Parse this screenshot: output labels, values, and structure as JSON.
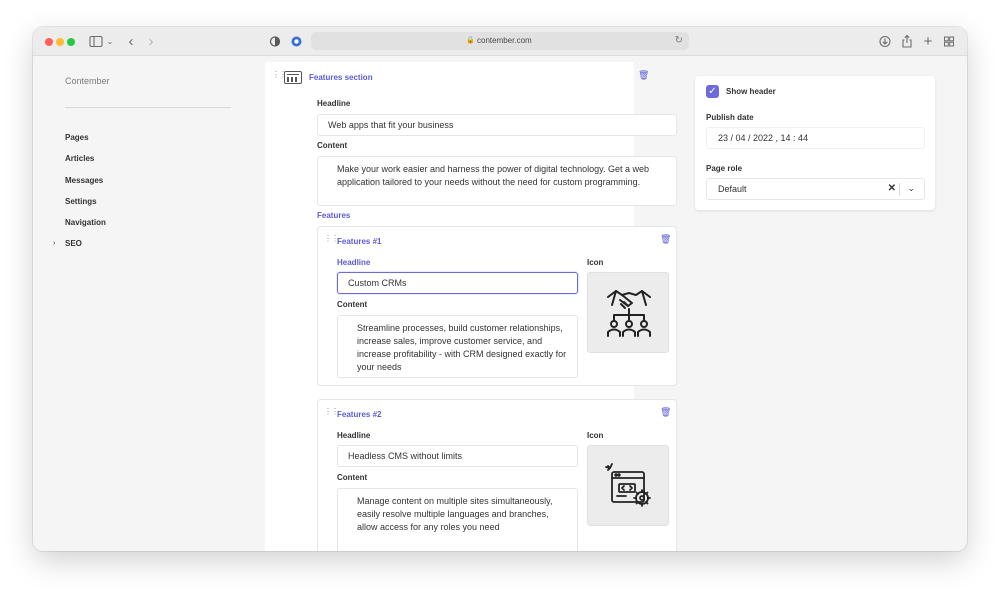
{
  "browser": {
    "url": "contember.com",
    "icons": {
      "sidebar_toggle": "sidebar-icon",
      "back": "chevron-left-icon",
      "forward": "chevron-right-icon",
      "shield": "shield-icon",
      "extension": "extension-icon",
      "lock": "lock-icon",
      "reload": "reload-icon",
      "download": "download-icon",
      "share": "share-icon",
      "new_tab": "plus-icon",
      "tab_overview": "grid-icon"
    }
  },
  "sidebar": {
    "brand": "Contember",
    "items": [
      {
        "label": "Pages"
      },
      {
        "label": "Articles"
      },
      {
        "label": "Messages"
      },
      {
        "label": "Settings"
      },
      {
        "label": "Navigation"
      },
      {
        "label": "SEO",
        "expandable": true
      }
    ]
  },
  "section": {
    "title": "Features section",
    "headline_label": "Headline",
    "headline_value": "Web apps that fit your business",
    "content_label": "Content",
    "content_value": "Make your work easier and harness the power of digital technology. Get a web application tailored to your needs without the need for custom programming.",
    "features_label": "Features",
    "features": [
      {
        "title": "Features #1",
        "headline_label": "Headline",
        "headline_value": "Custom CRMs",
        "content_label": "Content",
        "content_value": "Streamline processes, build customer relationships, increase sales, improve customer service, and increase profitability - with CRM designed exactly for your needs",
        "icon_label": "Icon",
        "icon": "handshake-team-icon"
      },
      {
        "title": "Features #2",
        "headline_label": "Headline",
        "headline_value": "Headless CMS without limits",
        "content_label": "Content",
        "content_value": "Manage content on multiple sites simultaneously, easily resolve multiple languages and branches, allow access for any roles you need",
        "icon_label": "Icon",
        "icon": "browser-code-gear-icon"
      }
    ]
  },
  "panel": {
    "show_header_label": "Show header",
    "show_header_checked": true,
    "publish_date_label": "Publish date",
    "publish_date_value": "23 / 04 / 2022 , 14 : 44",
    "page_role_label": "Page role",
    "page_role_value": "Default"
  },
  "colors": {
    "accent": "#5b5bd6",
    "window_bg": "#f5f5f5",
    "panel_bg": "#ffffff"
  }
}
